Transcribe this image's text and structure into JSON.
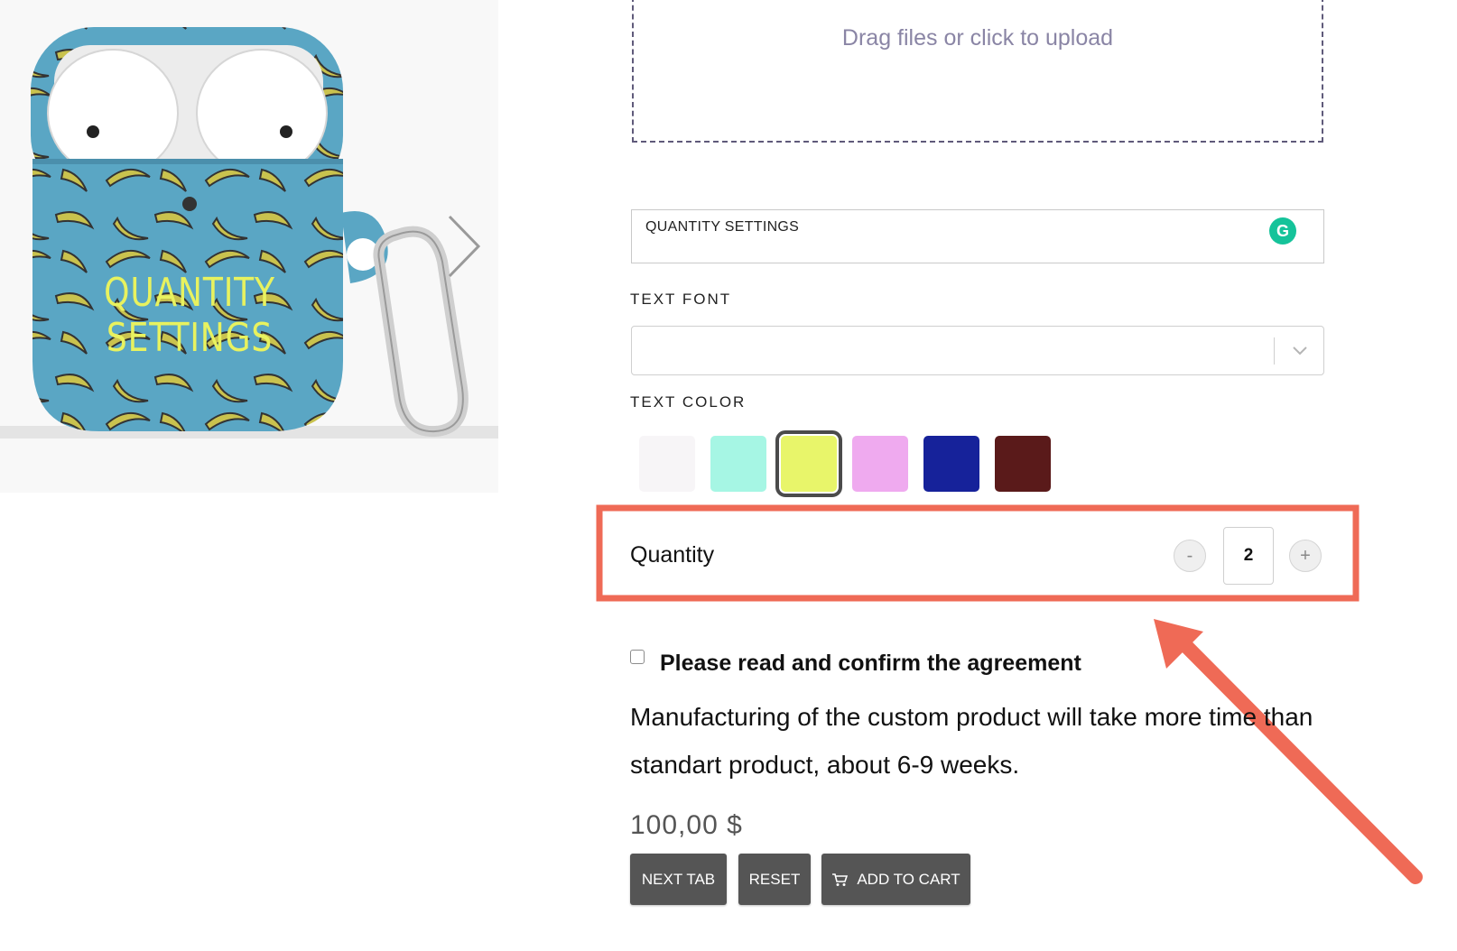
{
  "preview": {
    "case_text_line1": "QUANTITY",
    "case_text_line2": "SETTINGS",
    "next_icon": "chevron-right-icon"
  },
  "upload": {
    "label": "Drag files or click to upload"
  },
  "text_field": {
    "value": "QUANTITY SETTINGS",
    "extension_icon": "grammarly-icon",
    "extension_letter": "G"
  },
  "text_font": {
    "label": "TEXT FONT",
    "value": ""
  },
  "text_color": {
    "label": "TEXT COLOR",
    "swatches": [
      "#f7f5f7",
      "#a6f6e4",
      "#e8f56a",
      "#efaaef",
      "#16229a",
      "#5a1a1a"
    ],
    "selected": 2
  },
  "quantity": {
    "label": "Quantity",
    "minus": "-",
    "plus": "+",
    "value": "2"
  },
  "agreement": {
    "title": "Please read and confirm the agreement",
    "body": "Manufacturing of the custom product will take more time than standart product, about 6-9 weeks.",
    "checked": false
  },
  "price": "100,00 $",
  "buttons": {
    "next_tab": "NEXT TAB",
    "reset": "RESET",
    "add_to_cart": "ADD TO CART",
    "cart_icon": "cart-icon"
  },
  "colors": {
    "button_bg": "#555555",
    "annotation": "#ef6a56",
    "grammarly": "#15c39a"
  }
}
